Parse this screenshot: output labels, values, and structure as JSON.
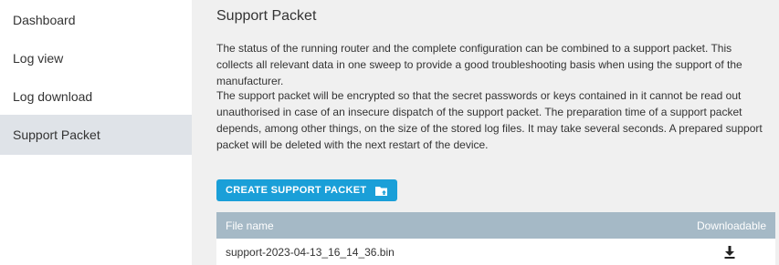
{
  "sidebar": {
    "items": [
      {
        "label": "Dashboard"
      },
      {
        "label": "Log view"
      },
      {
        "label": "Log download"
      },
      {
        "label": "Support Packet"
      }
    ]
  },
  "main": {
    "title": "Support Packet",
    "paragraph1": "The status of the running router and the complete configuration can be combined to a support packet. This collects all relevant data in one sweep to provide a good troubleshooting basis when using the support of the manufacturer.",
    "paragraph2": "The support packet will be encrypted so that the secret passwords or keys contained in it cannot be read out unauthorised in case of an insecure dispatch of the support packet. The preparation time of a support packet depends, among other things, on the size of the stored log files. It may take several seconds. A prepared support packet will be deleted with the next restart of the device.",
    "create_button": {
      "label": "CREATE SUPPORT PACKET",
      "icon": "folder-upload-icon"
    },
    "table": {
      "columns": [
        "File name",
        "Downloadable"
      ],
      "rows": [
        {
          "file_name": "support-2023-04-13_16_14_36.bin",
          "icon": "download-icon"
        }
      ]
    }
  },
  "colors": {
    "accent": "#1a9fd8",
    "sidebar_active": "#dfe3e8",
    "table_header": "#a5b9c6",
    "content_bg": "#f0f0f0"
  }
}
